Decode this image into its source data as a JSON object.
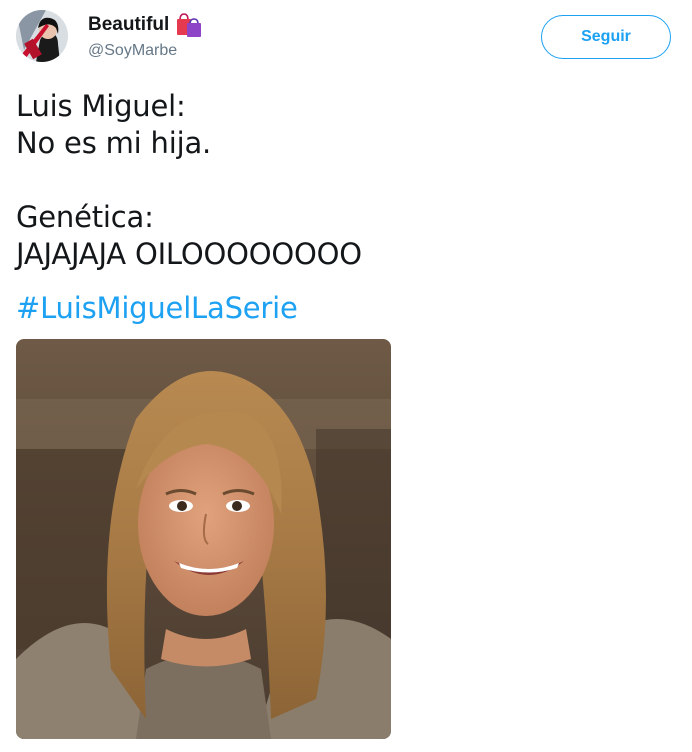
{
  "tweet": {
    "author": {
      "display_name": "Beautiful",
      "name_emoji_icon": "shopping-bags-icon",
      "handle": "@SoyMarbe",
      "avatar_icon": "user-avatar"
    },
    "follow_button_label": "Seguir",
    "text": "Luis Miguel:\nNo es mi hija.\n\nGenética:\nJAJAJAJA OILOOOOOOOO",
    "hashtag": "#LuisMiguelLaSerie",
    "media": {
      "type": "photo",
      "subject": "smiling young woman with long blonde hair"
    }
  },
  "colors": {
    "accent": "#1da1f2",
    "text": "#14171a",
    "secondary_text": "#657786",
    "background": "#ffffff"
  }
}
